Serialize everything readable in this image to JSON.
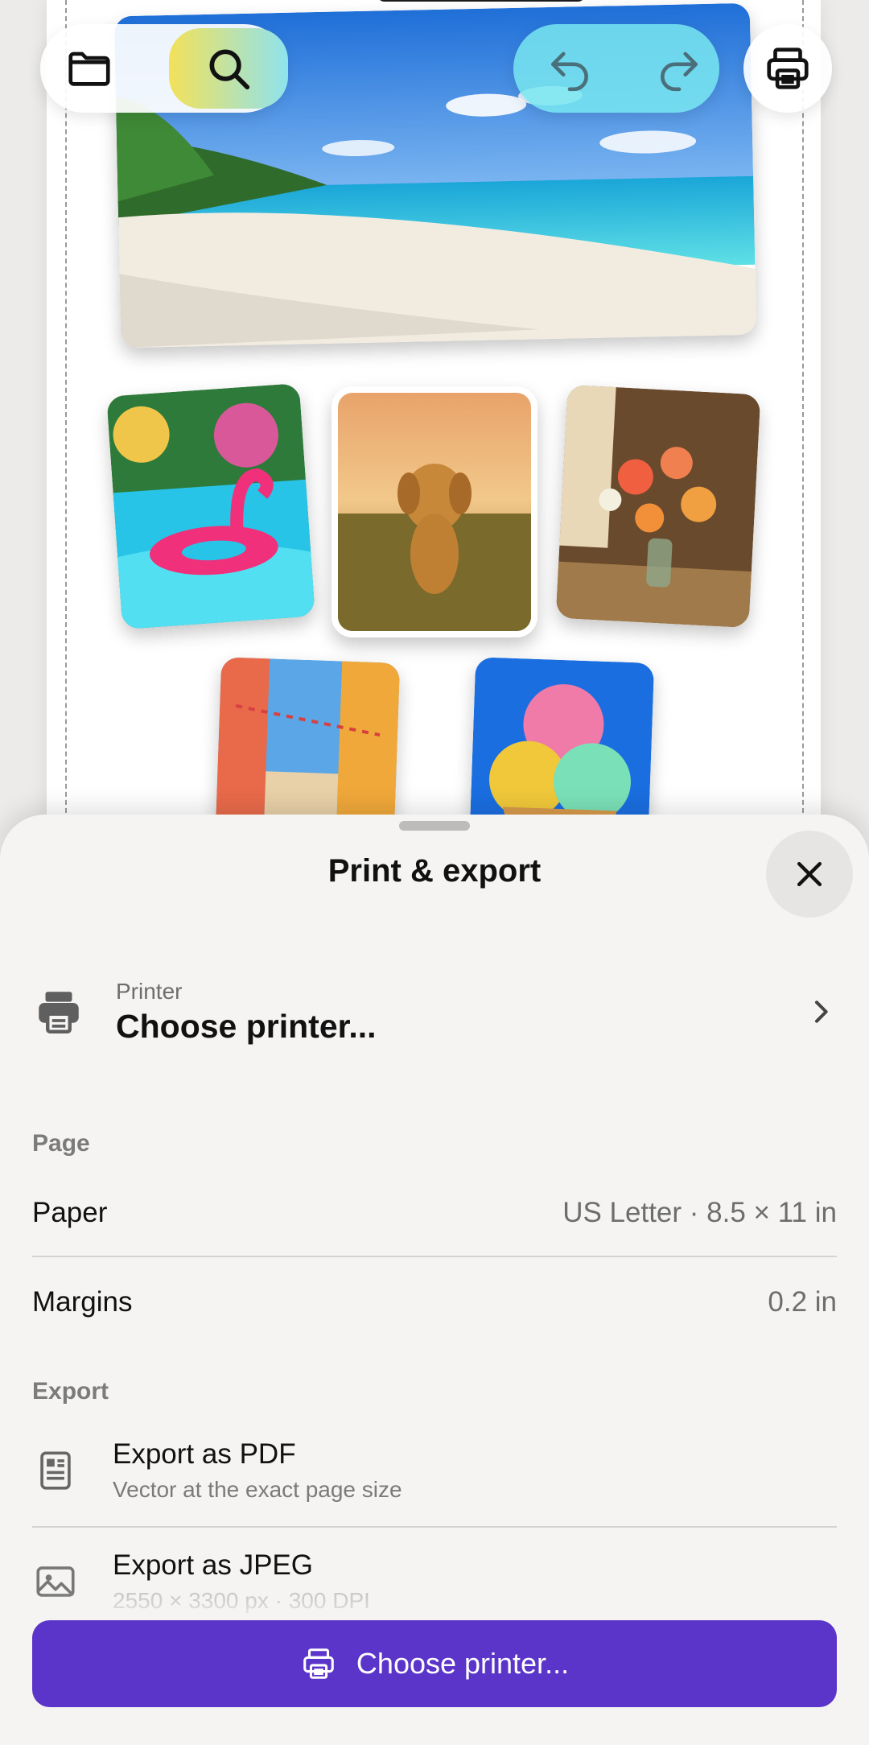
{
  "toolbar": {
    "files_icon": "folder-icon",
    "search_icon": "search-icon",
    "undo_icon": "undo-icon",
    "redo_icon": "redo-icon",
    "print_icon": "printer-icon"
  },
  "canvas": {
    "photos": [
      {
        "name": "beach",
        "description_icon": "photo-beach"
      },
      {
        "name": "flamingo-pool",
        "description_icon": "photo-flamingo"
      },
      {
        "name": "golden-retriever",
        "description_icon": "photo-dog"
      },
      {
        "name": "flower-vase",
        "description_icon": "photo-flowers"
      },
      {
        "name": "colorful-street",
        "description_icon": "photo-street"
      },
      {
        "name": "ice-cream",
        "description_icon": "photo-icecream"
      }
    ]
  },
  "sheet": {
    "title": "Print & export",
    "close_icon": "close-icon",
    "printer": {
      "label": "Printer",
      "value": "Choose printer..."
    },
    "page_section": {
      "label": "Page",
      "paper_label": "Paper",
      "paper_value": "US Letter · 8.5 × 11 in",
      "margins_label": "Margins",
      "margins_value": "0.2 in"
    },
    "export_section": {
      "label": "Export",
      "pdf_title": "Export as PDF",
      "pdf_subtitle": "Vector at the exact page size",
      "jpeg_title": "Export as JPEG",
      "jpeg_subtitle": "2550 × 3300 px · 300 DPI"
    },
    "primary_button": "Choose printer..."
  },
  "colors": {
    "accent": "#5b34c9",
    "sheet_bg": "#f5f4f2",
    "secondary_text": "#6d6d6d"
  }
}
